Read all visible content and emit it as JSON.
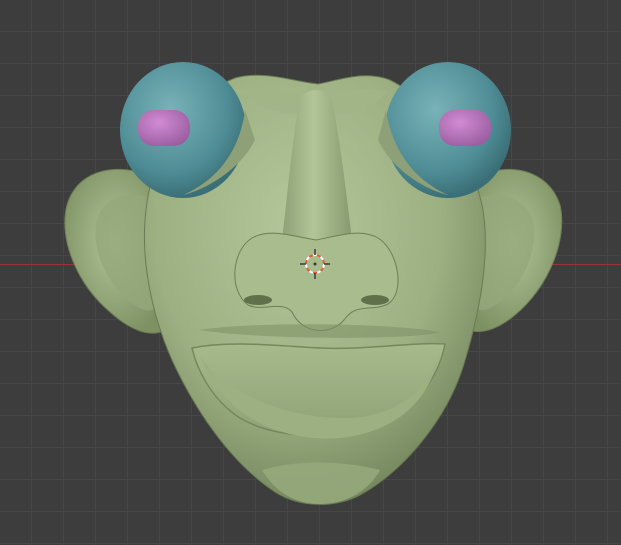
{
  "viewport": {
    "background": "#3d3d3d",
    "grid_color": "#474747",
    "x_axis_color": "#9a3535"
  },
  "model": {
    "skin_color": "#a6b98a",
    "skin_shadow": "#6f8058",
    "eye_color": "#5c98a0",
    "pupil_color": "#b574b6"
  },
  "cursor": {
    "icon": "3d-cursor-icon",
    "ring_color_a": "#e55a3a",
    "ring_color_b": "#ffffff"
  }
}
